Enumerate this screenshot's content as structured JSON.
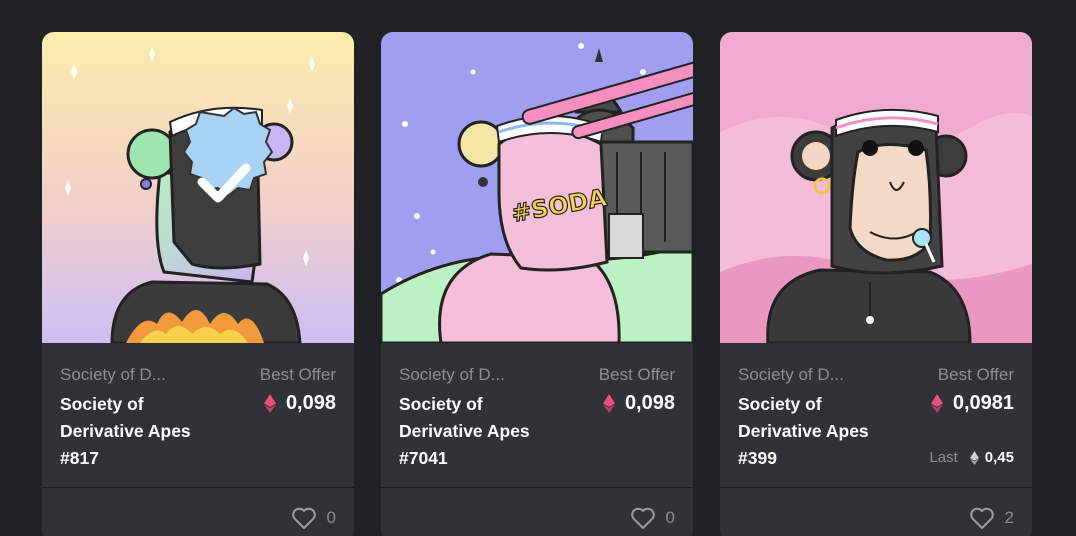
{
  "cards": [
    {
      "collection": "Society of D...",
      "name": "Society of Derivative Apes #817",
      "offer_label": "Best Offer",
      "price": "0,098",
      "favorites": "0"
    },
    {
      "collection": "Society of D...",
      "name": "Society of Derivative Apes #7041",
      "offer_label": "Best Offer",
      "price": "0,098",
      "favorites": "0",
      "art_text": "#SODA"
    },
    {
      "collection": "Society of D...",
      "name": "Society of Derivative Apes #399",
      "offer_label": "Best Offer",
      "price": "0,0981",
      "last_label": "Last",
      "last_price": "0,45",
      "favorites": "2"
    }
  ],
  "colors": {
    "background": "#202124",
    "card": "#303237",
    "muted_text": "#8b8e96",
    "eth_accent": "#e8527a"
  },
  "icons": [
    "eth-icon",
    "heart-icon"
  ]
}
